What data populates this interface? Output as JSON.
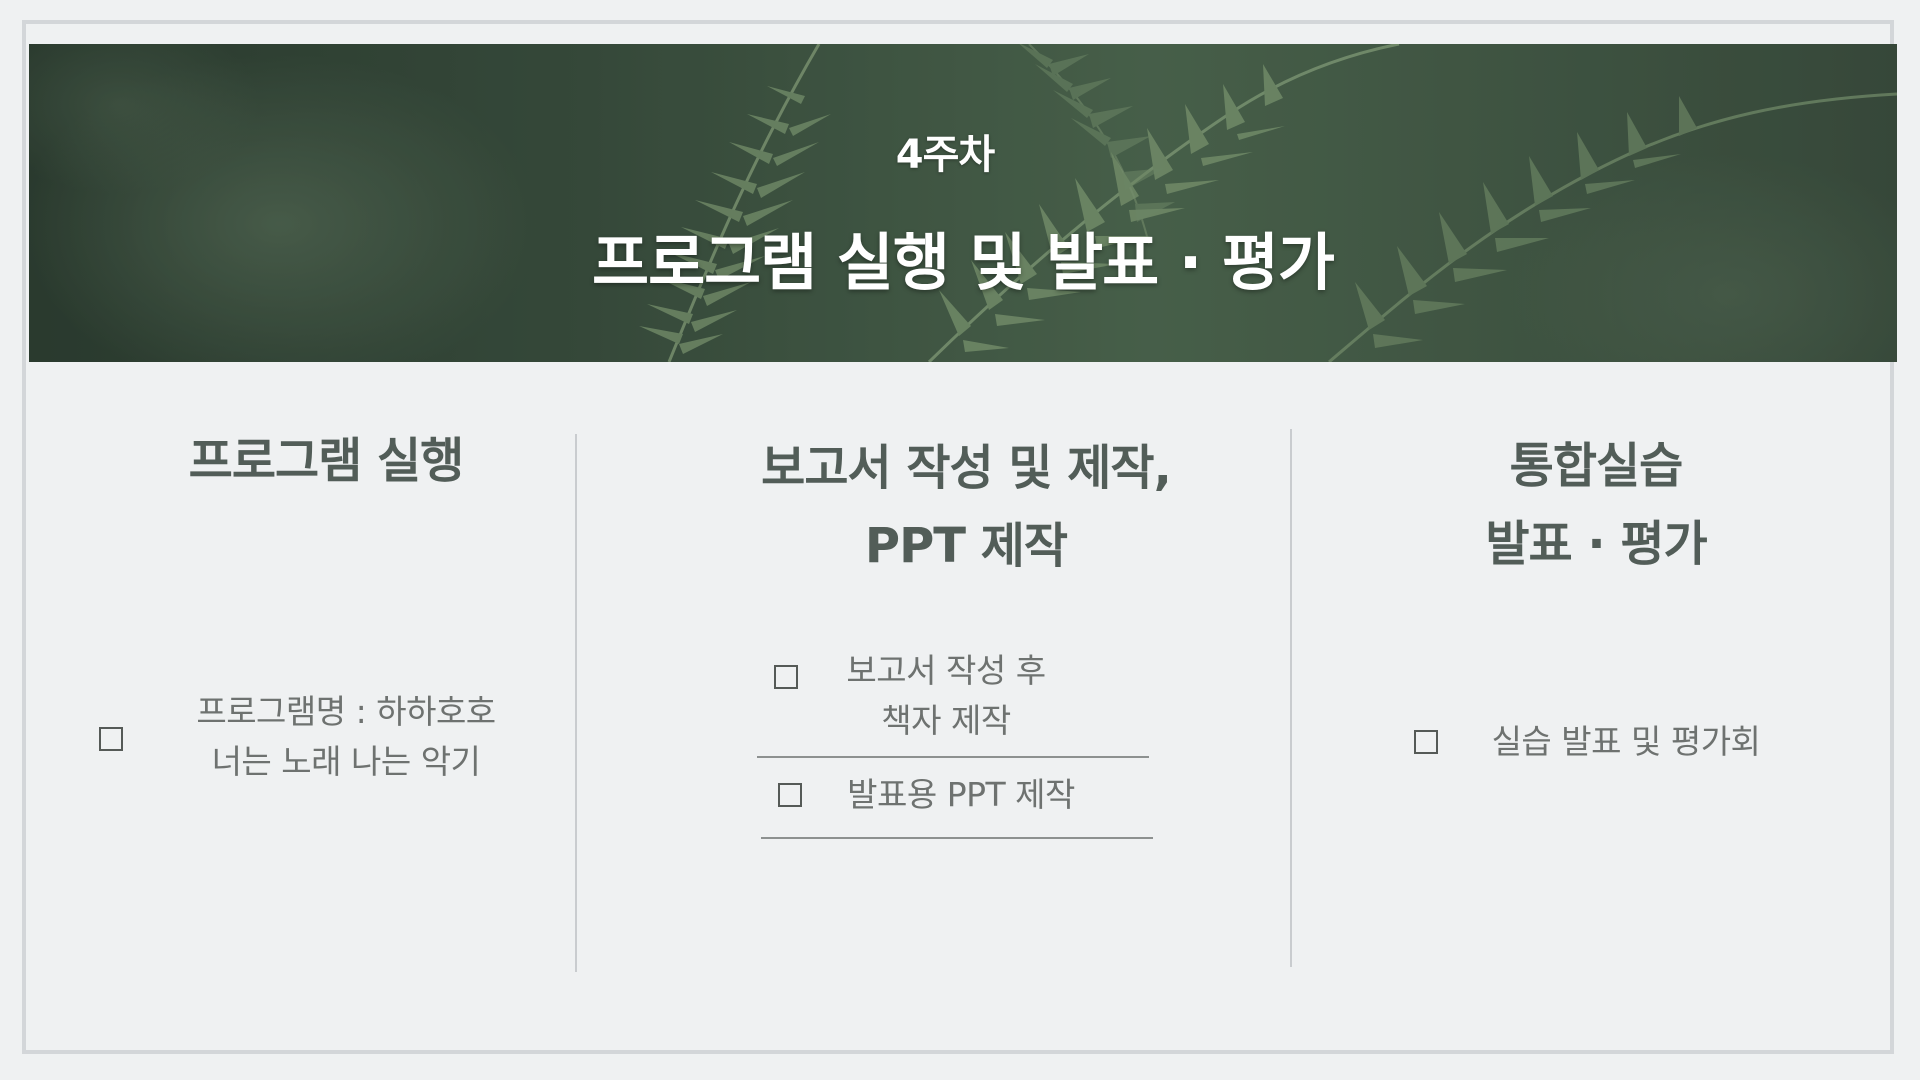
{
  "banner": {
    "week_label": "4주차",
    "title": "프로그램 실행 및 발표 · 평가"
  },
  "columns": [
    {
      "title_lines": [
        "프로그램 실행"
      ],
      "items": [
        {
          "lines": [
            "프로그램명 : 하하호호",
            "너는 노래 나는 악기"
          ]
        }
      ]
    },
    {
      "title_lines": [
        "보고서 작성 및 제작,",
        "PPT 제작"
      ],
      "items": [
        {
          "lines": [
            "보고서 작성 후",
            "책자 제작"
          ]
        },
        {
          "lines": [
            "발표용 PPT 제작"
          ]
        }
      ]
    },
    {
      "title_lines": [
        "통합실습",
        "발표 · 평가"
      ],
      "items": [
        {
          "lines": [
            "실습 발표 및 평가회"
          ]
        }
      ]
    }
  ],
  "colors": {
    "background": "#eff1f2",
    "border": "#d3d6d9",
    "heading": "#525d58",
    "body_text": "#6e7270",
    "banner_green": "#3f5544"
  }
}
